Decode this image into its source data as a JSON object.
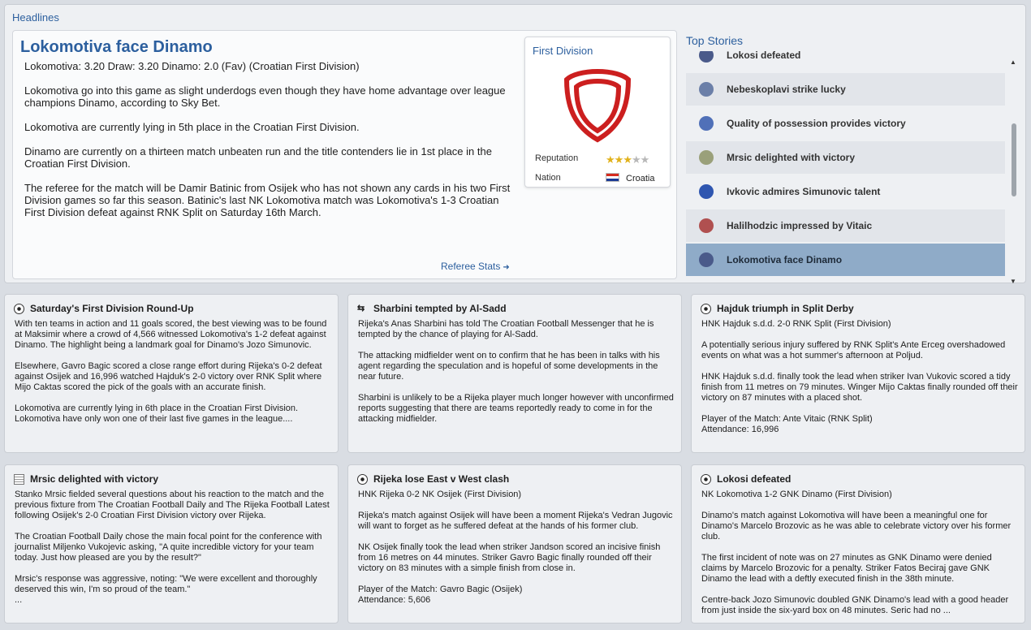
{
  "headlines": {
    "section_title": "Headlines",
    "story": {
      "title": "Lokomotiva face Dinamo",
      "odds": "Lokomotiva: 3.20  Draw: 3.20  Dinamo: 2.0 (Fav) (Croatian First Division)",
      "paragraphs": [
        "Lokomotiva go into this game as slight underdogs even though they have home advantage over league champions Dinamo, according to Sky Bet.",
        "Lokomotiva are currently lying in 5th place in the Croatian First Division.",
        "Dinamo are currently on a thirteen match unbeaten run and the title contenders lie in 1st place in the Croatian First Division.",
        "The referee for the match will be Damir Batinic from Osijek who has not shown any cards in his two First Division games so far this season. Batinic's last NK Lokomotiva match was Lokomotiva's 1-3 Croatian First Division defeat against RNK Split on Saturday 16th March."
      ],
      "referee_link": "Referee Stats"
    },
    "club_card": {
      "division": "First Division",
      "reputation_label": "Reputation",
      "reputation_stars": 2.5,
      "nation_label": "Nation",
      "nation_value": "Croatia"
    }
  },
  "top_stories": {
    "title": "Top Stories",
    "items": [
      {
        "label": "Lokosi defeated",
        "icon": "club-crest-icon",
        "color": "#4a5a8a"
      },
      {
        "label": "Nebeskoplavi strike lucky",
        "icon": "club-crest-icon",
        "color": "#6b7fa8"
      },
      {
        "label": "Quality of possession provides victory",
        "icon": "club-crest-icon",
        "color": "#5070b8"
      },
      {
        "label": "Mrsic delighted with victory",
        "icon": "club-crest-icon",
        "color": "#9aa07a"
      },
      {
        "label": "Ivkovic admires Simunovic talent",
        "icon": "club-crest-icon",
        "color": "#2f56b0"
      },
      {
        "label": "Halilhodzic impressed by Vitaic",
        "icon": "club-crest-icon",
        "color": "#b05050"
      },
      {
        "label": "Lokomotiva face Dinamo",
        "icon": "club-crest-icon",
        "color": "#4a5a8a"
      }
    ],
    "selected_index": 6
  },
  "news": [
    {
      "title": "Saturday's First Division Round-Up",
      "icon": "football-icon",
      "paragraphs": [
        "With ten teams in action and 11 goals scored, the best viewing was to be found at Maksimir where a crowd of 4,566 witnessed Lokomotiva's 1-2 defeat against Dinamo. The highlight being a landmark goal for Dinamo's Jozo Simunovic.",
        "Elsewhere, Gavro Bagic scored a close range effort during Rijeka's 0-2 defeat against Osijek and 16,996 watched Hajduk's 2-0 victory over RNK Split where Mijo Caktas scored the pick of the goals with an accurate finish.",
        "Lokomotiva are currently lying in 6th place in the Croatian First Division. Lokomotiva have only won one of their last five games in the league...."
      ]
    },
    {
      "title": "Sharbini tempted by Al-Sadd",
      "icon": "transfer-arrows-icon",
      "paragraphs": [
        "Rijeka's Anas Sharbini has told The Croatian Football Messenger that he is tempted by the chance of playing for Al-Sadd.",
        "The attacking midfielder went on to confirm that he has been in talks with his agent regarding the speculation and is hopeful of some developments in the near future.",
        "Sharbini is unlikely to be a Rijeka player much longer however with unconfirmed reports suggesting that there are teams reportedly ready to come in for the attacking midfielder."
      ]
    },
    {
      "title": "Hajduk triumph in Split Derby",
      "icon": "football-icon",
      "paragraphs": [
        "HNK Hajduk s.d.d. 2-0 RNK Split (First Division)",
        "A potentially serious injury suffered by RNK Split's Ante Erceg overshadowed events on what was a hot summer's afternoon at Poljud.",
        "HNK Hajduk s.d.d. finally took the lead when striker Ivan Vukovic scored a tidy finish from 11 metres on 79 minutes. Winger Mijo Caktas finally rounded off their victory on 87 minutes with a placed shot.",
        "Player of the Match: Ante Vitaic (RNK Split)\nAttendance: 16,996"
      ]
    },
    {
      "title": "Mrsic delighted with victory",
      "icon": "newspaper-icon",
      "paragraphs": [
        "Stanko Mrsic fielded several questions about his reaction to the match and the previous fixture from The Croatian Football Daily and The Rijeka Football Latest following Osijek's 2-0 Croatian First Division victory over Rijeka.",
        "The Croatian Football Daily chose the main focal point for the conference with journalist Miljenko Vukojevic asking, \"A quite incredible victory for your team today. Just how pleased are you by the result?\"",
        "Mrsic's response was aggressive, noting: \"We were excellent and thoroughly deserved this win, I'm so proud of the team.\"\n..."
      ]
    },
    {
      "title": "Rijeka lose East v West clash",
      "icon": "football-icon",
      "paragraphs": [
        "HNK Rijeka 0-2 NK Osijek (First Division)",
        "Rijeka's match against Osijek will have been a moment Rijeka's Vedran Jugovic will want to forget as he suffered defeat at the hands of his former club.",
        "NK Osijek finally took the lead when striker Jandson scored an incisive finish from 16 metres on 44 minutes. Striker Gavro Bagic finally rounded off their victory on 83 minutes with a simple finish from close in.",
        "Player of the Match: Gavro Bagic (Osijek)\nAttendance: 5,606"
      ]
    },
    {
      "title": "Lokosi defeated",
      "icon": "football-icon",
      "paragraphs": [
        "NK Lokomotiva 1-2 GNK Dinamo (First Division)",
        "Dinamo's match against Lokomotiva will have been a meaningful one for Dinamo's Marcelo Brozovic as he was able to celebrate victory over his former club.",
        "The first incident of note was on 27 minutes as GNK Dinamo were denied claims by Marcelo Brozovic for a penalty. Striker Fatos Beciraj gave GNK Dinamo the lead with a deftly executed finish in the 38th minute.",
        "Centre-back Jozo Simunovic doubled GNK Dinamo's lead with a good header from just inside the six-yard box on 48 minutes. Seric had no ..."
      ]
    }
  ]
}
